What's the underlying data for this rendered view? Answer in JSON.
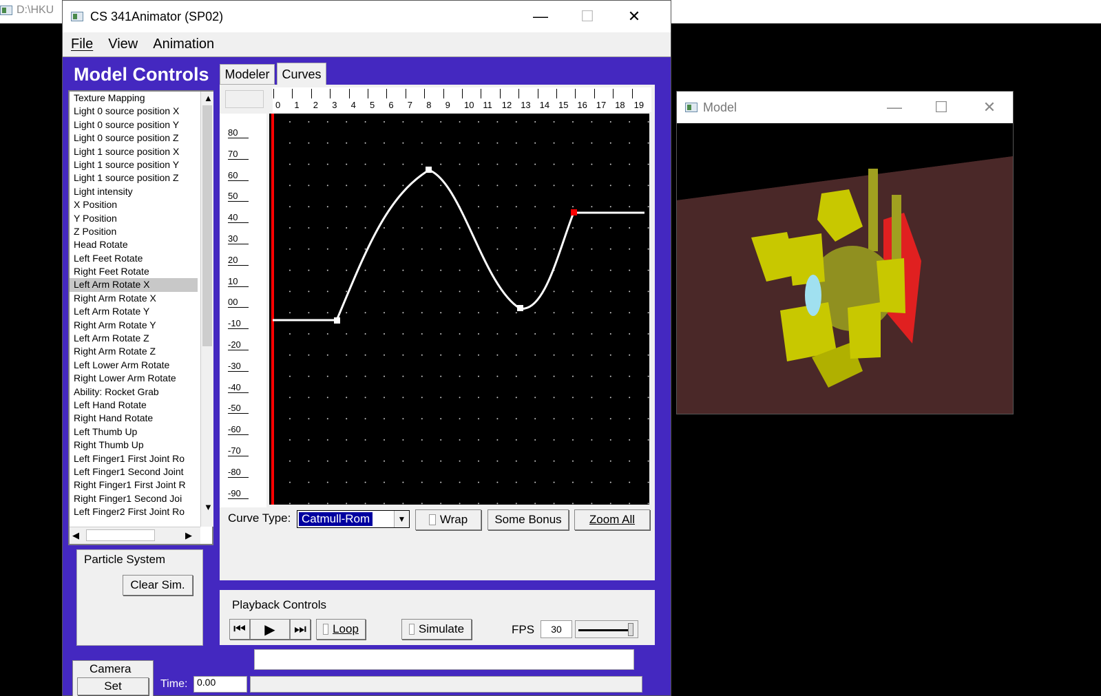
{
  "background": {
    "path_text": "D:\\HKU"
  },
  "main_window": {
    "title": "CS 341Animator (SP02)",
    "minimize": "—",
    "maximize": "☐",
    "close": "✕",
    "menu": [
      "File",
      "View",
      "Animation"
    ]
  },
  "model_controls": {
    "title": "Model Controls",
    "list_items": [
      "Texture Mapping",
      "Light 0 source position X",
      "Light 0 source position Y",
      "Light 0 source position Z",
      "Light 1 source position X",
      "Light 1 source position Y",
      "Light 1 source position Z",
      "Light intensity",
      "X Position",
      "Y Position",
      "Z Position",
      "Head Rotate",
      "Left Feet Rotate",
      "Right Feet Rotate",
      "Left Arm Rotate X",
      "Right Arm Rotate X",
      "Left Arm Rotate Y",
      "Right Arm Rotate Y",
      "Left Arm Rotate Z",
      "Right Arm Rotate Z",
      "Left Lower Arm Rotate",
      "Right Lower Arm Rotate",
      "Ability: Rocket Grab",
      "Left Hand Rotate",
      "Right Hand Rotate",
      "Left Thumb Up",
      "Right Thumb Up",
      "Left Finger1 First Joint Ro",
      "Left Finger1 Second Joint",
      "Right Finger1 First Joint R",
      "Right Finger1 Second Joi",
      "Left Finger2 First Joint Ro"
    ],
    "selected_index": 14
  },
  "tabs": {
    "modeler": "Modeler",
    "curves": "Curves"
  },
  "curves": {
    "x_ticks": [
      "0",
      "1",
      "2",
      "3",
      "4",
      "5",
      "6",
      "7",
      "8",
      "9",
      "10",
      "11",
      "12",
      "13",
      "14",
      "15",
      "16",
      "17",
      "18",
      "19"
    ],
    "y_ticks": [
      "80",
      "70",
      "60",
      "50",
      "40",
      "30",
      "20",
      "10",
      "00",
      "-10",
      "-20",
      "-30",
      "-40",
      "-50",
      "-60",
      "-70",
      "-80",
      "-90"
    ],
    "curve_type_label": "Curve Type:",
    "curve_type_value": "Catmull-Rom",
    "wrap_label": "Wrap",
    "some_bonus_label": "Some Bonus",
    "zoom_all_label": "Zoom All"
  },
  "particle_system": {
    "title": "Particle System",
    "clear_sim_label": "Clear Sim."
  },
  "playback": {
    "title": "Playback Controls",
    "loop_label": "Loop",
    "simulate_label": "Simulate",
    "fps_label": "FPS",
    "fps_value": "30"
  },
  "camera": {
    "title": "Camera",
    "set_label": "Set",
    "time_label": "Time:",
    "time_value": "0.00"
  },
  "model_window": {
    "title": "Model",
    "minimize": "—",
    "maximize": "☐",
    "close": "✕"
  },
  "colors": {
    "panel_bg": "#4428c0",
    "curve_color": "#ffffff",
    "time_marker": "#ff0000",
    "floor": "#4a2828",
    "robot": "#c8c800"
  }
}
